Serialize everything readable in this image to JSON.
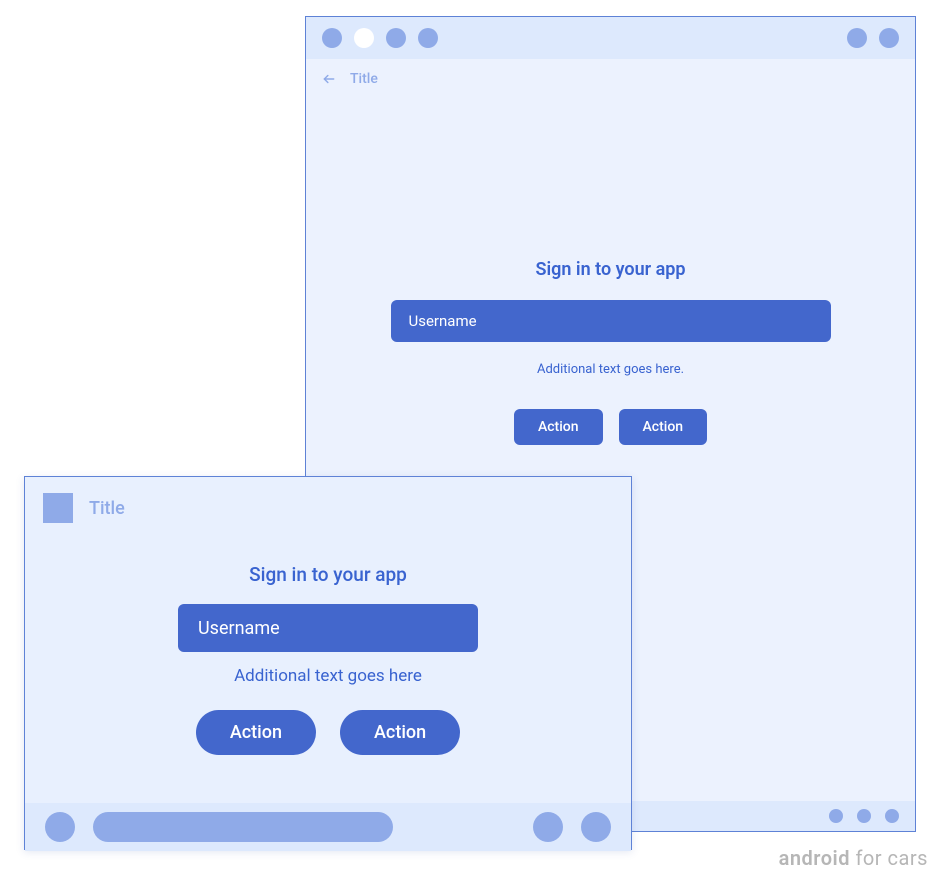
{
  "tablet": {
    "appbar": {
      "title": "Title"
    },
    "signin": {
      "heading": "Sign in to your app",
      "placeholder": "Username",
      "additional": "Additional text goes here.",
      "action1": "Action",
      "action2": "Action"
    }
  },
  "phone": {
    "appbar": {
      "title": "Title"
    },
    "signin": {
      "heading": "Sign in to your app",
      "placeholder": "Username",
      "additional": "Additional text goes here",
      "action1": "Action",
      "action2": "Action"
    }
  },
  "watermark": {
    "bold": "android",
    "rest": " for cars"
  }
}
